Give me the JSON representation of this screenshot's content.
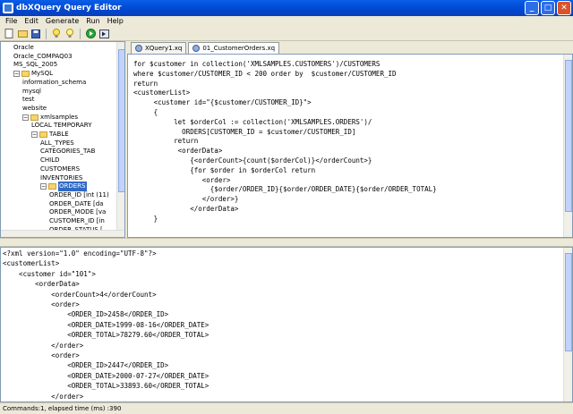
{
  "window": {
    "title": "dbXQuery Query Editor"
  },
  "menu": [
    "File",
    "Edit",
    "Generate",
    "Run",
    "Help"
  ],
  "toolbar": {
    "icons": [
      "new-file-icon",
      "open-folder-icon",
      "save-icon",
      "hint-icon",
      "bulb-icon",
      "run-icon",
      "step-icon"
    ]
  },
  "tree": {
    "items": [
      {
        "label": "Oracle",
        "indent": 0,
        "folder": false
      },
      {
        "label": "Oracle_COMPAQ03",
        "indent": 0,
        "folder": false
      },
      {
        "label": "MS_SQL_2005",
        "indent": 0,
        "folder": false
      },
      {
        "label": "MySQL",
        "indent": 0,
        "folder": true,
        "expanded": true
      },
      {
        "label": "information_schema",
        "indent": 1,
        "folder": false
      },
      {
        "label": "mysql",
        "indent": 1,
        "folder": false
      },
      {
        "label": "test",
        "indent": 1,
        "folder": false
      },
      {
        "label": "website",
        "indent": 1,
        "folder": false
      },
      {
        "label": "xmlsamples",
        "indent": 1,
        "folder": true,
        "expanded": true
      },
      {
        "label": "LOCAL TEMPORARY",
        "indent": 2,
        "folder": false
      },
      {
        "label": "TABLE",
        "indent": 2,
        "folder": true,
        "expanded": true
      },
      {
        "label": "ALL_TYPES",
        "indent": 3,
        "folder": false
      },
      {
        "label": "CATEGORIES_TAB",
        "indent": 3,
        "folder": false
      },
      {
        "label": "CHILD",
        "indent": 3,
        "folder": false
      },
      {
        "label": "CUSTOMERS",
        "indent": 3,
        "folder": false
      },
      {
        "label": "INVENTORIES",
        "indent": 3,
        "folder": false
      },
      {
        "label": "ORDERS",
        "indent": 3,
        "folder": true,
        "expanded": true,
        "selected": true
      },
      {
        "label": "ORDER_ID [int (11)",
        "indent": 4,
        "folder": false
      },
      {
        "label": "ORDER_DATE [da",
        "indent": 4,
        "folder": false
      },
      {
        "label": "ORDER_MODE [va",
        "indent": 4,
        "folder": false
      },
      {
        "label": "CUSTOMER_ID [in",
        "indent": 4,
        "folder": false
      },
      {
        "label": "ORDER_STATUS [",
        "indent": 4,
        "folder": false
      }
    ]
  },
  "tabs": [
    {
      "label": "XQuery1.xq",
      "active": false
    },
    {
      "label": "01_CustomerOrders.xq",
      "active": true
    }
  ],
  "editor": {
    "lines": [
      "for $customer in collection('XMLSAMPLES.CUSTOMERS')/CUSTOMERS",
      "where $customer/CUSTOMER_ID < 200 order by  $customer/CUSTOMER_ID",
      "return",
      "<customerList>",
      "     <customer id=\"{$customer/CUSTOMER_ID}\">",
      "     {",
      "          let $orderCol := collection('XMLSAMPLES.ORDERS')/",
      "            ORDERS[CUSTOMER_ID = $customer/CUSTOMER_ID]",
      "          return",
      "           <orderData>",
      "              {<orderCount>{count($orderCol)}</orderCount>}",
      "              {for $order in $orderCol return",
      "                 <order>",
      "                   {$order/ORDER_ID}{$order/ORDER_DATE}{$order/ORDER_TOTAL}",
      "                 </order>}",
      "              </orderData>",
      "     }"
    ]
  },
  "result": {
    "lines": [
      "<?xml version=\"1.0\" encoding=\"UTF-8\"?>",
      "<customerList>",
      "    <customer id=\"101\">",
      "        <orderData>",
      "            <orderCount>4</orderCount>",
      "            <order>",
      "                <ORDER_ID>2458</ORDER_ID>",
      "                <ORDER_DATE>1999-08-16</ORDER_DATE>",
      "                <ORDER_TOTAL>78279.60</ORDER_TOTAL>",
      "            </order>",
      "            <order>",
      "                <ORDER_ID>2447</ORDER_ID>",
      "                <ORDER_DATE>2000-07-27</ORDER_DATE>",
      "                <ORDER_TOTAL>33893.60</ORDER_TOTAL>",
      "            </order>"
    ]
  },
  "status": {
    "text": "Commands:1, elapsed time (ms) :390"
  }
}
